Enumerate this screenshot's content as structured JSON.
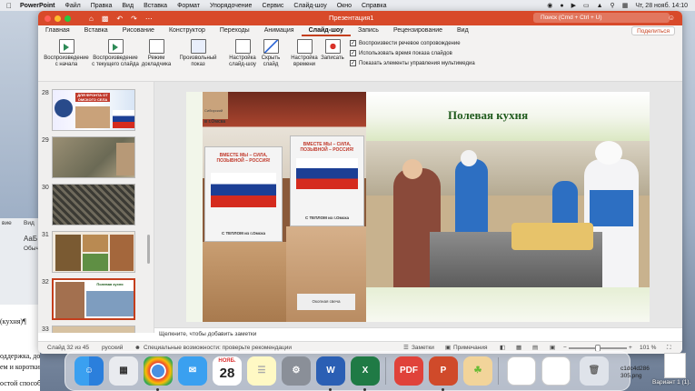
{
  "menubar": {
    "app": "PowerPoint",
    "items": [
      "Файл",
      "Правка",
      "Вид",
      "Вставка",
      "Формат",
      "Упорядочение",
      "Сервис",
      "Слайд-шоу",
      "Окно",
      "Справка"
    ],
    "clock": "Чт, 28 нояб. 14:10"
  },
  "window": {
    "title": "Презентация1",
    "search_placeholder": "Поиск (Cmd + Ctrl + U)"
  },
  "tabs": [
    "Главная",
    "Вставка",
    "Рисование",
    "Конструктор",
    "Переходы",
    "Анимация",
    "Слайд-шоу",
    "Запись",
    "Рецензирование",
    "Вид"
  ],
  "active_tab": "Слайд-шоу",
  "share_label": "Поделиться",
  "ribbon": {
    "buttons": [
      {
        "label1": "Воспроизведение",
        "label2": "с начала"
      },
      {
        "label1": "Воспроизведение",
        "label2": "с текущего слайда"
      },
      {
        "label1": "Режим",
        "label2": "докладчика"
      },
      {
        "label1": "Произвольный",
        "label2": "показ"
      },
      {
        "label1": "Настройка",
        "label2": "слайд-шоу"
      },
      {
        "label1": "Скрыть",
        "label2": "слайд"
      },
      {
        "label1": "Настройка",
        "label2": "времени"
      },
      {
        "label1": "Записать",
        "label2": ""
      }
    ],
    "checks": [
      {
        "label": "Воспроизвести речевое сопровождение",
        "checked": true
      },
      {
        "label": "Использовать время показа слайдов",
        "checked": true
      },
      {
        "label": "Показать элементы управления мультимедиа",
        "checked": true
      }
    ]
  },
  "thumbnails": [
    {
      "num": "28"
    },
    {
      "num": "29"
    },
    {
      "num": "30"
    },
    {
      "num": "31"
    },
    {
      "num": "32"
    },
    {
      "num": "33"
    }
  ],
  "thumb28_text": "ДЛЯ ФРОНТА ОТ ОМСКОГО СЕЛА",
  "thumb32_text": "Полевая кухня",
  "slide": {
    "title": "Полевая кухня",
    "poster1_title": "ВМЕСТЕ МЫ – СИЛА, ПОЗЫВНОЙ – РОССИЯ!",
    "poster1_bottom": "С ТЕПЛОМ из г.Омска",
    "poster2_title": "ВМЕСТЕ МЫ – СИЛА, ПОЗЫВНОЙ – РОССИЯ!",
    "poster2_bottom": "С ТЕПЛОМ из г.Омска",
    "box_label": "в г.Омска",
    "box_label2": "Сибирский",
    "box_label3": "Окопная свеча"
  },
  "notes_placeholder": "Щелкните, чтобы добавить заметки",
  "status": {
    "slide": "Слайд 32 из 45",
    "language": "русский",
    "accessibility": "Специальные возможности: проверьте рекомендации",
    "notes": "Заметки",
    "comments": "Примечания",
    "zoom": "101 %"
  },
  "dock": {
    "calendar_month": "НОЯБ.",
    "calendar_day": "28",
    "file_name1": "c1dc4d286",
    "file_name2": "305.png",
    "desktop_label": "Вариант 1 (1)."
  },
  "doc_behind": {
    "lines": [
      "(кухня)¶",
      "оддержка, доброе с",
      "ем и коротких запис",
      "остой способ связат"
    ],
    "ribbon1": "вие",
    "ribbon2": "Вид",
    "ribbon3": "АаБ",
    "ribbon4": "Обычн"
  }
}
